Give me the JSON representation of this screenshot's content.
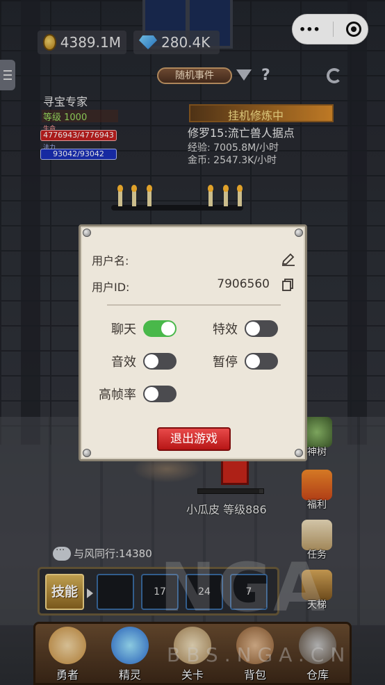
{
  "currency": {
    "gold": "4389.1M",
    "gems": "280.4K"
  },
  "capsule": {
    "more_glyph": "•••"
  },
  "header": {
    "event_button": "随机事件",
    "help": "?"
  },
  "player": {
    "name": "寻宝专家",
    "level": "等级 1000",
    "hp_label": "生命",
    "hp": "4776943/4776943",
    "mp_label": "法力",
    "mp": "93042/93042"
  },
  "idle": {
    "status": "挂机修炼中",
    "stage": "修罗15:流亡兽人据点",
    "exp": "经验: 7005.8M/小时",
    "gold": "金币: 2547.3K/小时"
  },
  "settings_dialog": {
    "username_label": "用户名:",
    "userid_label": "用户ID:",
    "userid_value": "7906560",
    "options": [
      {
        "label": "聊天",
        "on": true
      },
      {
        "label": "特效",
        "on": false
      },
      {
        "label": "音效",
        "on": false
      },
      {
        "label": "暂停",
        "on": false
      },
      {
        "label": "高帧率",
        "on": false
      }
    ],
    "exit_button": "退出游戏"
  },
  "side_buttons": [
    {
      "label": "神树",
      "icon": "tree-icon"
    },
    {
      "label": "福利",
      "icon": "gift-icon"
    },
    {
      "label": "任务",
      "icon": "scroll-icon"
    },
    {
      "label": "天梯",
      "icon": "ladder-icon"
    }
  ],
  "enemy": {
    "name": "小瓜皮 等级886"
  },
  "chat": {
    "text": "与风同行:14380"
  },
  "skills": {
    "button": "技能",
    "slots": [
      "",
      "17",
      "24",
      "7"
    ]
  },
  "bottom_tabs": [
    {
      "label": "勇者",
      "icon": "hero-icon"
    },
    {
      "label": "精灵",
      "icon": "spirit-icon"
    },
    {
      "label": "关卡",
      "icon": "map-icon"
    },
    {
      "label": "背包",
      "icon": "bag-icon"
    },
    {
      "label": "仓库",
      "icon": "chest-icon"
    }
  ],
  "watermark": {
    "logo": "NGA",
    "url": "BBS.NGA.CN"
  },
  "colors": {
    "toggle_on": "#49b84a",
    "toggle_off": "#4b4b4f",
    "exit_red": "#d42a2a",
    "dialog_bg": "#ece6da"
  }
}
